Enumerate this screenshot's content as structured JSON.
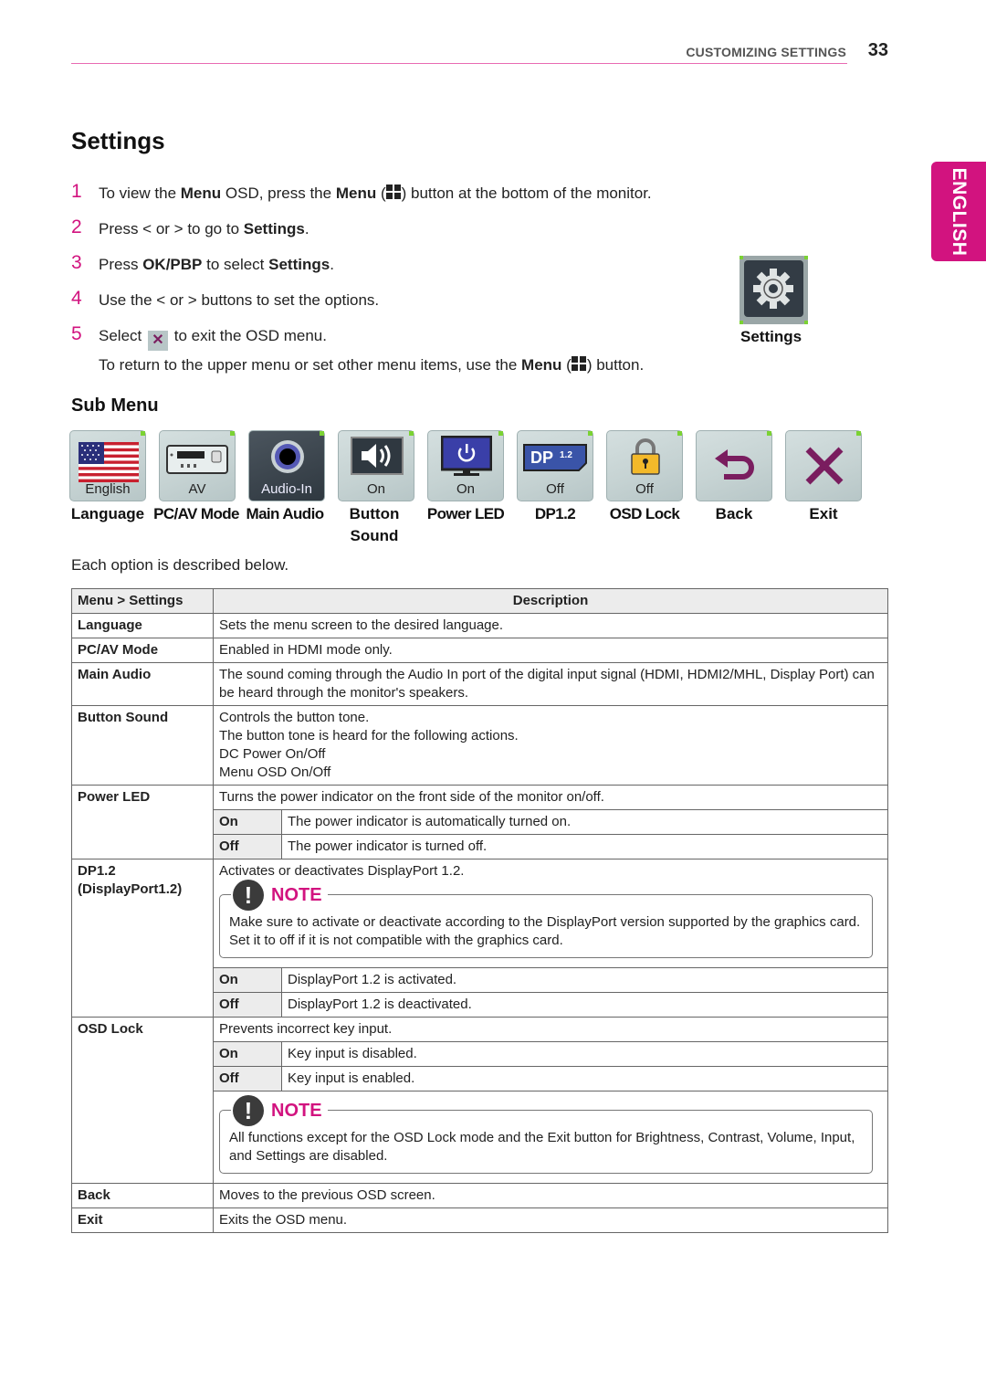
{
  "header": {
    "section_title": "CUSTOMIZING SETTINGS",
    "page_number": "33"
  },
  "language_tab": "ENGLISH",
  "title": "Settings",
  "steps": [
    {
      "num": "1",
      "parts": [
        "To view the ",
        "Menu",
        " OSD, press the ",
        "Menu",
        " (",
        ") button at the bottom of the monitor."
      ]
    },
    {
      "num": "2",
      "parts": [
        "Press < or > to go to ",
        "Settings",
        "."
      ]
    },
    {
      "num": "3",
      "parts": [
        "Press ",
        "OK/PBP",
        " to select ",
        "Settings",
        "."
      ]
    },
    {
      "num": "4",
      "parts": [
        "Use the < or > buttons to set the options."
      ]
    },
    {
      "num": "5",
      "parts": [
        "Select ",
        "to exit the OSD menu."
      ]
    }
  ],
  "return_line": {
    "before": "To return to the upper menu or set other menu items, use the ",
    "bold": "Menu",
    "paren_open": " (",
    "after": ") button."
  },
  "settings_icon_caption": "Settings",
  "sub_menu_title": "Sub Menu",
  "sub_menu_tiles": [
    {
      "value": "English",
      "label": "Language",
      "icon": "us-flag-icon"
    },
    {
      "value": "AV",
      "label": "PC/AV Mode",
      "icon": "av-device-icon"
    },
    {
      "value": "Audio-In",
      "label": "Main Audio",
      "icon": "audio-jack-icon"
    },
    {
      "value": "On",
      "label": "Button Sound",
      "icon": "speaker-icon"
    },
    {
      "value": "On",
      "label": "Power LED",
      "icon": "monitor-power-icon"
    },
    {
      "value": "Off",
      "label": "DP1.2",
      "icon": "displayport-icon"
    },
    {
      "value": "Off",
      "label": "OSD Lock",
      "icon": "padlock-icon"
    },
    {
      "value": "",
      "label": "Back",
      "icon": "back-arrow-icon"
    },
    {
      "value": "",
      "label": "Exit",
      "icon": "close-x-icon"
    }
  ],
  "desc_intro": "Each option is described below.",
  "table": {
    "headers": [
      "Menu > Settings",
      "Description"
    ],
    "rows": {
      "language": {
        "item": "Language",
        "desc": "Sets the menu screen to the desired language."
      },
      "pcav": {
        "item": "PC/AV Mode",
        "desc": "Enabled in HDMI mode only."
      },
      "main_audio": {
        "item": "Main Audio",
        "desc": "The sound coming through the Audio In port of the digital input signal (HDMI, HDMI2/MHL, Display Port) can be heard through the monitor's speakers."
      },
      "button_sound": {
        "item": "Button Sound",
        "lines": [
          "Controls the button tone.",
          "The button tone is heard for the following actions.",
          "DC Power On/Off",
          "Menu OSD On/Off"
        ]
      },
      "power_led": {
        "item": "Power LED",
        "desc": "Turns the power indicator on the front side of the monitor on/off.",
        "options": [
          {
            "opt": "On",
            "text": "The power indicator is automatically turned on."
          },
          {
            "opt": "Off",
            "text": "The power indicator is turned off."
          }
        ]
      },
      "dp12": {
        "item": "DP1.2",
        "item2": "(DisplayPort1.2)",
        "desc": "Activates or deactivates DisplayPort 1.2.",
        "note_title": "NOTE",
        "note": "Make sure to activate or deactivate according to the DisplayPort version supported by the graphics card. Set it to off if it is not compatible with the graphics card.",
        "options": [
          {
            "opt": "On",
            "text": "DisplayPort 1.2 is activated."
          },
          {
            "opt": "Off",
            "text": "DisplayPort 1.2 is deactivated."
          }
        ]
      },
      "osd_lock": {
        "item": "OSD Lock",
        "desc": "Prevents incorrect key input.",
        "options": [
          {
            "opt": "On",
            "text": "Key input is disabled."
          },
          {
            "opt": "Off",
            "text": "Key input is enabled."
          }
        ],
        "note_title": "NOTE",
        "note": "All functions except for the OSD Lock mode and the Exit button for Brightness, Contrast, Volume, Input, and Settings are disabled."
      },
      "back": {
        "item": "Back",
        "desc": "Moves to the previous OSD screen."
      },
      "exit": {
        "item": "Exit",
        "desc": "Exits the OSD menu."
      }
    }
  },
  "colors": {
    "accent": "#d2137f",
    "tile_bg": "#c6d3d3",
    "exit_x": "#7a1d5f"
  }
}
